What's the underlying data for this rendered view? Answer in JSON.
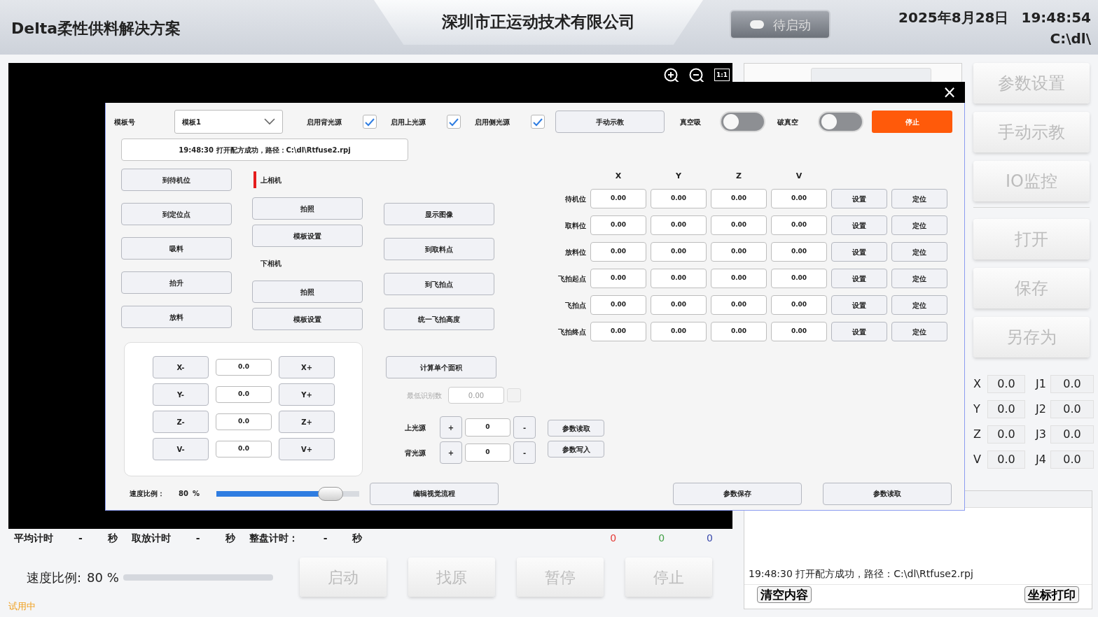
{
  "header": {
    "title": "Delta柔性供料解决方案",
    "company": "深圳市正运动技术有限公司",
    "status_button": {
      "label": "待启动",
      "disabled": true
    },
    "date": "2025年8月28日",
    "time": "19:48:54",
    "path": "C:\\dl\\"
  },
  "viewer": {
    "fit_label": "1:1"
  },
  "stats": {
    "items": [
      {
        "label": "平均计时",
        "value": "-",
        "unit": "秒"
      },
      {
        "label": "取放计时",
        "value": "-",
        "unit": "秒"
      },
      {
        "label": "整盘计时：",
        "value": "-",
        "unit": "秒"
      }
    ],
    "counters": [
      {
        "value": "0",
        "color": "#e53935"
      },
      {
        "value": "0",
        "color": "#43a047"
      },
      {
        "value": "0",
        "color": "#3949ab"
      }
    ]
  },
  "speed": {
    "label": "速度比例:",
    "value": "80 %"
  },
  "run_buttons": [
    {
      "label": "启动",
      "disabled": true
    },
    {
      "label": "找原",
      "disabled": true
    },
    {
      "label": "暂停",
      "disabled": true
    },
    {
      "label": "停止",
      "disabled": true
    }
  ],
  "trial": "试用中",
  "sidebar": {
    "buttons": [
      {
        "label": "参数设置",
        "disabled": true
      },
      {
        "label": "手动示教",
        "disabled": true
      },
      {
        "label": "IO监控",
        "disabled": true
      },
      {
        "label": "打开",
        "disabled": true
      },
      {
        "label": "保存",
        "disabled": true
      },
      {
        "label": "另存为",
        "disabled": true
      }
    ],
    "coords": [
      {
        "axis": "X",
        "value": "0.0",
        "joint": "J1",
        "joint_value": "0.0"
      },
      {
        "axis": "Y",
        "value": "0.0",
        "joint": "J2",
        "joint_value": "0.0"
      },
      {
        "axis": "Z",
        "value": "0.0",
        "joint": "J3",
        "joint_value": "0.0"
      },
      {
        "axis": "V",
        "value": "0.0",
        "joint": "J4",
        "joint_value": "0.0"
      }
    ]
  },
  "log": {
    "lines": [
      "19:48:30 打开配方成功，路径：C:\\dl\\Rtfuse2.rpj"
    ],
    "buttons": [
      "清空内容",
      "坐标打印"
    ]
  },
  "dialog": {
    "close": "×",
    "template_label": "模板号",
    "template_value": "模板1",
    "checks": [
      {
        "label": "启用背光源",
        "checked": true
      },
      {
        "label": "启用上光源",
        "checked": true
      },
      {
        "label": "启用侧光源",
        "checked": true
      }
    ],
    "teach_button": "手动示教",
    "toggles": [
      {
        "label": "真空吸",
        "on": false
      },
      {
        "label": "破真空",
        "on": false
      }
    ],
    "stop_button": "停止",
    "message": "19:48:30 打开配方成功，路径：C:\\dl\\Rtfuse2.rpj",
    "motion_buttons": [
      "到待机位",
      "到定位点",
      "吸料",
      "抬升",
      "放料"
    ],
    "cameras": [
      {
        "label": "上相机",
        "selected": true,
        "buttons": [
          "拍照",
          "模板设置"
        ]
      },
      {
        "label": "下相机",
        "selected": false,
        "buttons": [
          "拍照",
          "模板设置"
        ]
      }
    ],
    "action_buttons": [
      "显示图像",
      "到取料点",
      "到飞拍点",
      "统一飞拍高度"
    ],
    "points": {
      "columns": [
        "X",
        "Y",
        "Z",
        "V"
      ],
      "rows": [
        {
          "name": "待机位",
          "values": [
            "0.00",
            "0.00",
            "0.00",
            "0.00"
          ],
          "set": "设置",
          "locate": "定位"
        },
        {
          "name": "取料位",
          "values": [
            "0.00",
            "0.00",
            "0.00",
            "0.00"
          ],
          "set": "设置",
          "locate": "定位"
        },
        {
          "name": "放料位",
          "values": [
            "0.00",
            "0.00",
            "0.00",
            "0.00"
          ],
          "set": "设置",
          "locate": "定位"
        },
        {
          "name": "飞拍起点",
          "values": [
            "0.00",
            "0.00",
            "0.00",
            "0.00"
          ],
          "set": "设置",
          "locate": "定位"
        },
        {
          "name": "飞拍点",
          "values": [
            "0.00",
            "0.00",
            "0.00",
            "0.00"
          ],
          "set": "设置",
          "locate": "定位"
        },
        {
          "name": "飞拍终点",
          "values": [
            "0.00",
            "0.00",
            "0.00",
            "0.00"
          ],
          "set": "设置",
          "locate": "定位"
        }
      ]
    },
    "jog": [
      {
        "minus": "X-",
        "value": "0.0",
        "plus": "X+"
      },
      {
        "minus": "Y-",
        "value": "0.0",
        "plus": "Y+"
      },
      {
        "minus": "Z-",
        "value": "0.0",
        "plus": "Z+"
      },
      {
        "minus": "V-",
        "value": "0.0",
        "plus": "V+"
      }
    ],
    "area_button": "计算单个面积",
    "min_count": {
      "label": "最低识别数",
      "value": "0.00",
      "disabled": true,
      "checked": false
    },
    "lights": [
      {
        "label": "上光源",
        "plus": "+",
        "value": "0",
        "minus": "-"
      },
      {
        "label": "背光源",
        "plus": "+",
        "value": "0",
        "minus": "-"
      }
    ],
    "param_buttons": [
      "参数读取",
      "参数写入"
    ],
    "speed": {
      "label": "速度比例：",
      "value": "80",
      "unit": "%",
      "level": 0.8
    },
    "vision_button": "编辑视觉流程",
    "footer_buttons": [
      "参数保存",
      "参数读取"
    ]
  }
}
